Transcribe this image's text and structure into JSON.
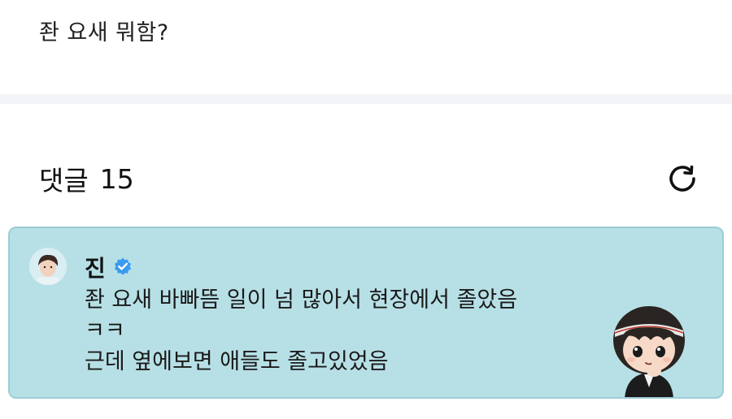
{
  "post": {
    "text": "좐 요새 뭐함?"
  },
  "comments": {
    "label": "댓글",
    "count": "15",
    "refresh_icon": "refresh-icon"
  },
  "comment": {
    "author": "진",
    "verified_icon": "verified-badge-icon",
    "lines": [
      "좐 요새 바빠뜸 일이 넘 많아서 현장에서 졸았음",
      "ㅋㅋ",
      "근데 옆에보면 애들도 졸고있었음"
    ],
    "card_color": "#b7e0e6",
    "sticker_icon": "character-sticker-icon"
  }
}
